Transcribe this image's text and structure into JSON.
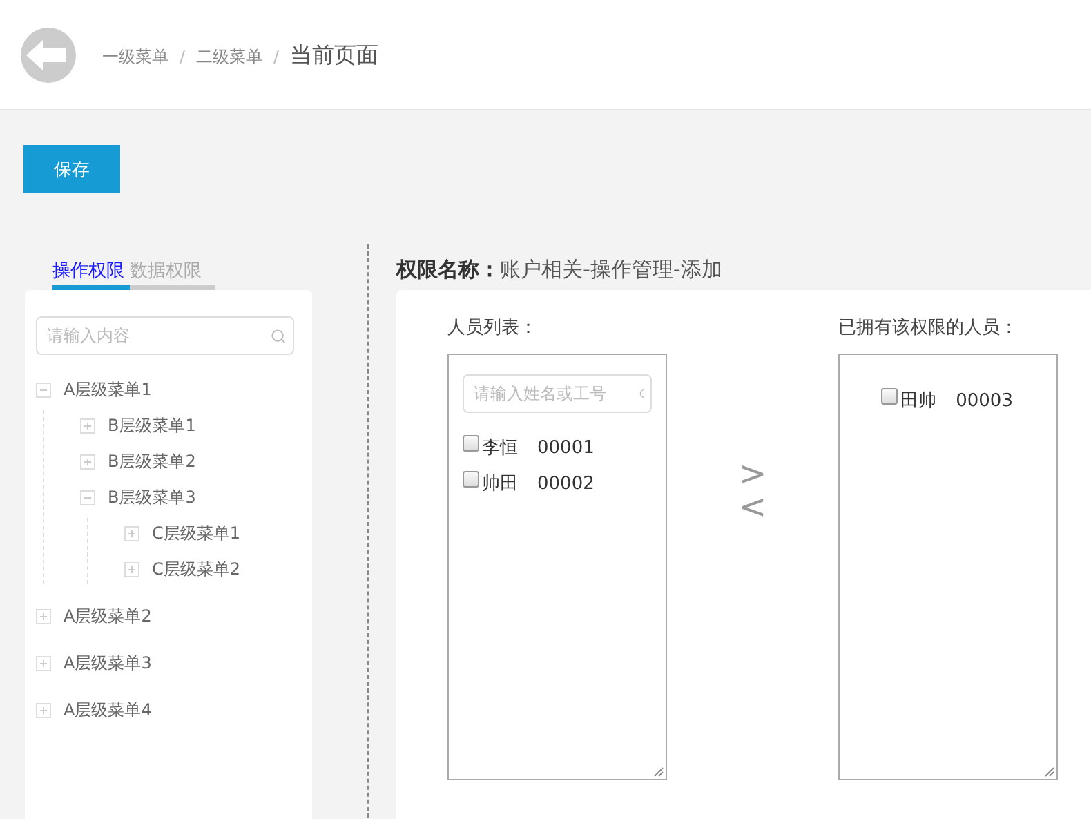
{
  "breadcrumb": [
    {
      "label": "一级菜单",
      "current": false
    },
    {
      "label": "二级菜单",
      "current": false
    },
    {
      "label": "当前页面",
      "current": true
    }
  ],
  "breadcrumb_separator": "/",
  "save_button": "保存",
  "tabs": [
    {
      "label": "操作权限",
      "selected": true
    },
    {
      "label": "数据权限",
      "selected": false
    }
  ],
  "tree": {
    "search": {
      "placeholder": "请输入内容"
    },
    "items": [
      {
        "label": "A层级菜单1",
        "expanded": true,
        "children": [
          {
            "label": "B层级菜单1",
            "expanded": false
          },
          {
            "label": "B层级菜单2",
            "expanded": false
          },
          {
            "label": "B层级菜单3",
            "expanded": true,
            "children": [
              {
                "label": "C层级菜单1",
                "expanded": false
              },
              {
                "label": "C层级菜单2",
                "expanded": false
              }
            ]
          }
        ]
      },
      {
        "label": "A层级菜单2",
        "expanded": false
      },
      {
        "label": "A层级菜单3",
        "expanded": false
      },
      {
        "label": "A层级菜单4",
        "expanded": false
      }
    ]
  },
  "permission": {
    "label": "权限名称：",
    "value": "账户相关-操作管理-添加"
  },
  "people_list": {
    "title": "人员列表：",
    "search": {
      "placeholder": "请输入姓名或工号"
    },
    "people": [
      {
        "name": "李恒",
        "id": "00001",
        "checked": false
      },
      {
        "name": "帅田",
        "id": "00002",
        "checked": false
      }
    ]
  },
  "transfer": {
    "add": ">",
    "remove": "<"
  },
  "granted_list": {
    "title": "已拥有该权限的人员：",
    "people": [
      {
        "name": "田帅",
        "id": "00003",
        "checked": false
      }
    ]
  }
}
